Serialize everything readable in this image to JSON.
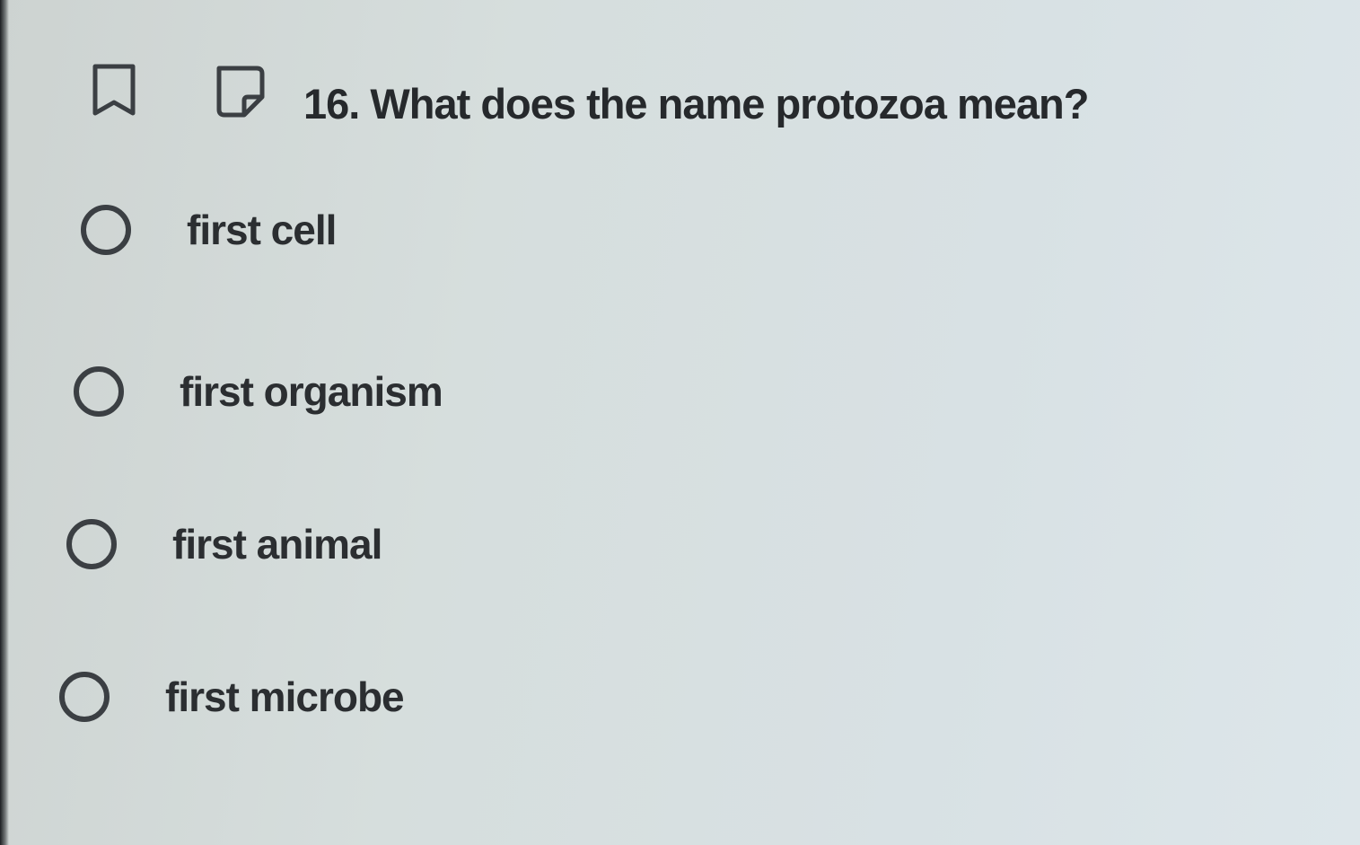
{
  "question": {
    "text": "16. What does the name protozoa mean?",
    "icons": [
      "bookmark-icon",
      "note-icon"
    ]
  },
  "options": [
    {
      "label": "first cell",
      "selected": false
    },
    {
      "label": "first organism",
      "selected": false
    },
    {
      "label": "first animal",
      "selected": false
    },
    {
      "label": "first microbe",
      "selected": false
    }
  ],
  "colors": {
    "text": "#2a2d30",
    "radio_border": "#3b3f43",
    "background": "#d6dedd"
  }
}
